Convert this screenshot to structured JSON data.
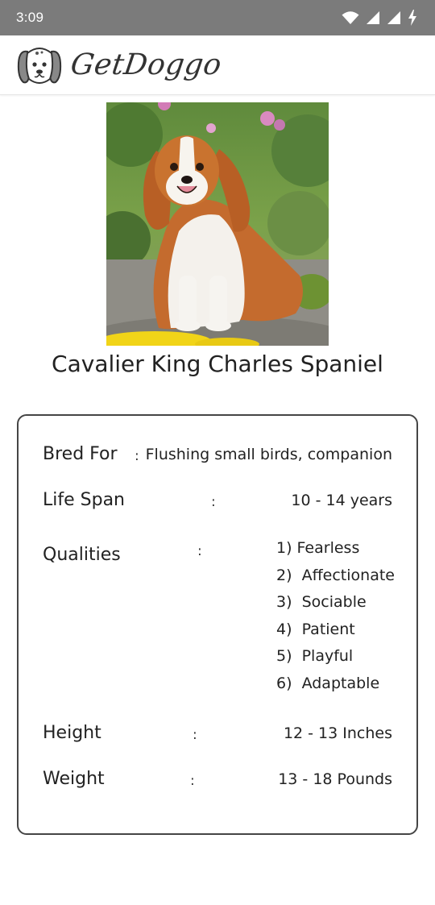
{
  "status_bar": {
    "time": "3:09",
    "icons": [
      "wifi-icon",
      "signal-icon",
      "signal-icon",
      "battery-charging-icon"
    ]
  },
  "header": {
    "brand_name": "GetDoggo",
    "logo_icon": "dog-face-icon"
  },
  "breed": {
    "name": "Cavalier King Charles Spaniel",
    "image_icon": "dog-photo"
  },
  "details": {
    "bred_for": {
      "label": "Bred For",
      "separator": ":",
      "value": "Flushing small birds, companion"
    },
    "life_span": {
      "label": "Life Span",
      "separator": ":",
      "value": "10 - 14 years"
    },
    "qualities": {
      "label": "Qualities",
      "separator": ":",
      "items": [
        "1) Fearless",
        "2)  Affectionate",
        "3)  Sociable",
        "4)  Patient",
        "5)  Playful",
        "6)  Adaptable"
      ]
    },
    "height": {
      "label": "Height",
      "separator": ":",
      "value": "12 - 13 Inches"
    },
    "weight": {
      "label": "Weight",
      "separator": ":",
      "value": "13 - 18 Pounds"
    }
  },
  "colors": {
    "status_bar_bg": "#7b7b7b",
    "card_border": "#454545",
    "text": "#222222"
  }
}
